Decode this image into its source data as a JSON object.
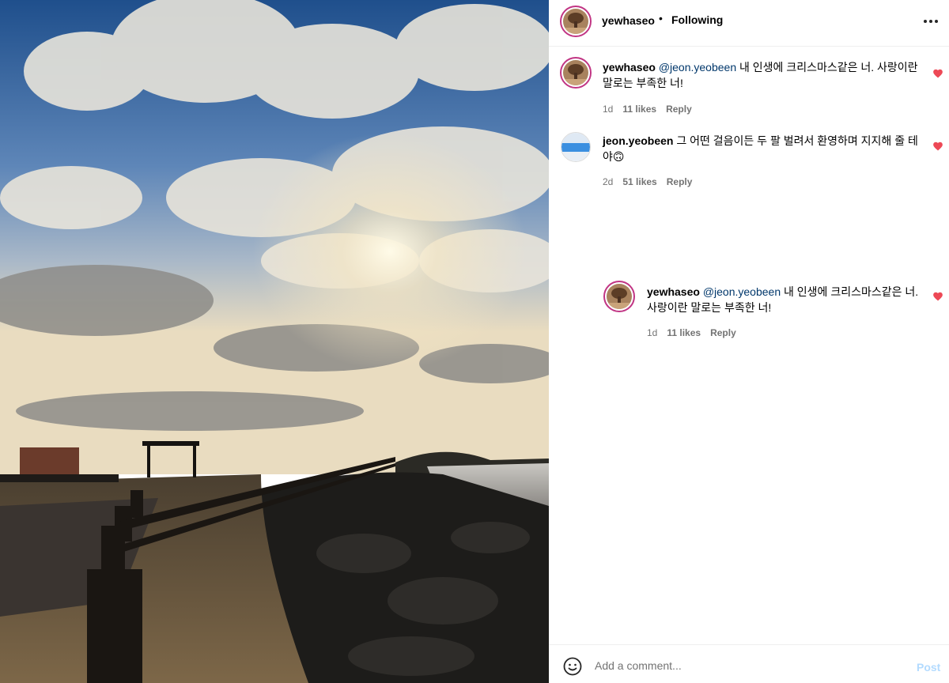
{
  "post": {
    "author": "yewhaseo",
    "separator": "•",
    "follow_status": "Following",
    "more_icon": "more-horizontal-icon"
  },
  "comments": [
    {
      "username": "yewhaseo",
      "mention": "@jeon.yeobeen",
      "text_line1": " 내 인생에 크리스마스같은 너. 사랑이란",
      "text_line2": "말로는 부족한 너!",
      "time": "1d",
      "likes": "11 likes",
      "reply": "Reply"
    },
    {
      "username": "jeon.yeobeen",
      "text_line1": " 그 어떤 걸음이든 두 팔 벌려서 환영하며 지지해 줄 테",
      "text_line2": "야🙃",
      "time": "2d",
      "likes": "51 likes",
      "reply": "Reply"
    },
    {
      "username": "yewhaseo",
      "mention": "@jeon.yeobeen",
      "text_line1": " 내 인생에 크리스마스같은 너.",
      "text_line2": "사랑이란 말로는 부족한 너!",
      "time": "1d",
      "likes": "11 likes",
      "reply": "Reply"
    }
  ],
  "add_comment": {
    "placeholder": "Add a comment...",
    "post_label": "Post"
  },
  "colors": {
    "heart": "#ed4956",
    "mention": "#00376b",
    "meta": "#737373",
    "post_disabled": "#b3dbff",
    "story_ring": "#c13584"
  }
}
